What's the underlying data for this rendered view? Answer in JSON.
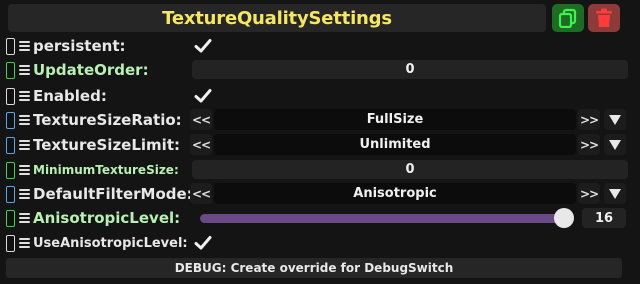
{
  "header": {
    "title": "TextureQualitySettings",
    "copy_icon": "copy-icon",
    "delete_icon": "trash-icon",
    "copy_color": "#1e6b24",
    "delete_color": "#8c3a3a"
  },
  "properties": [
    {
      "label": "persistent:",
      "control": "checkbox",
      "checked": true
    },
    {
      "label": "UpdateOrder:",
      "control": "number",
      "value": "0"
    },
    {
      "label": "Enabled:",
      "control": "checkbox",
      "checked": true
    },
    {
      "label": "TextureSizeRatio:",
      "control": "enum",
      "value": "FullSize",
      "prev_label": "<<",
      "next_label": ">>"
    },
    {
      "label": "TextureSizeLimit:",
      "control": "enum",
      "value": "Unlimited",
      "prev_label": "<<",
      "next_label": ">>"
    },
    {
      "label": "MinimumTextureSize:",
      "control": "number",
      "value": "0"
    },
    {
      "label": "DefaultFilterMode:",
      "control": "enum",
      "value": "Anisotropic",
      "prev_label": "<<",
      "next_label": ">>"
    },
    {
      "label": "AnisotropicLevel:",
      "control": "slider",
      "value": "16",
      "fraction": 0.99
    },
    {
      "label": "UseAnisotropicLevel:",
      "control": "checkbox",
      "checked": true
    }
  ],
  "debug": {
    "label": "DEBUG: Create override for DebugSwitch"
  },
  "colors": {
    "title": "#f5e663",
    "slider": "#6a4a86",
    "green_label": "#b8f0b4"
  }
}
